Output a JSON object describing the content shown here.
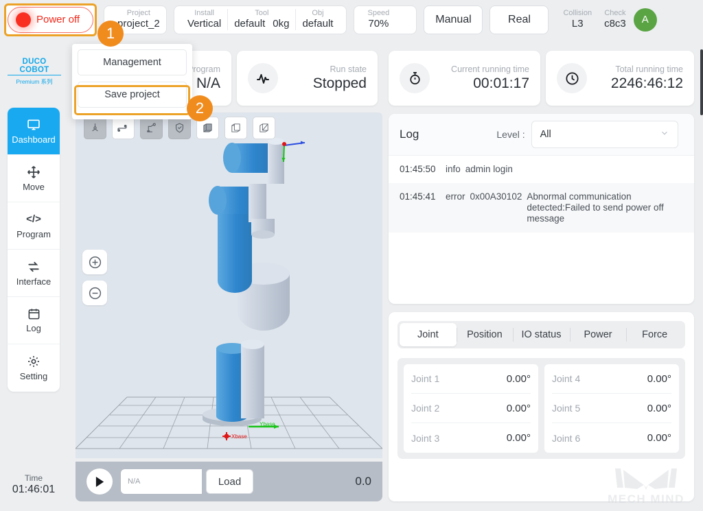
{
  "topbar": {
    "power": {
      "label": "Power off",
      "dot_color": "#f92f22",
      "highlight_color": "#eca227"
    },
    "project": {
      "key": "Project",
      "value": "project_2"
    },
    "install": {
      "key": "Install",
      "value": "Vertical"
    },
    "tool": {
      "key": "Tool",
      "value": "default",
      "payload": "0kg"
    },
    "obj": {
      "key": "Obj",
      "value": "default"
    },
    "speed": {
      "key": "Speed",
      "value": "70%"
    },
    "mode_button": "Manual",
    "real_button": "Real",
    "collision": {
      "key": "Collision",
      "value": "L3"
    },
    "check": {
      "key": "Check",
      "value": "c8c3"
    },
    "avatar": {
      "initial": "A",
      "color": "#5aa444"
    }
  },
  "branding": {
    "logo_main": "DUCO COBOT",
    "logo_sub": "Premium 系列",
    "color": "#13a7e8"
  },
  "sidebar": {
    "items": [
      {
        "label": "Dashboard",
        "icon": "monitor-icon",
        "active": true
      },
      {
        "label": "Move",
        "icon": "move-arrows-icon",
        "active": false
      },
      {
        "label": "Program",
        "icon": "code-icon",
        "active": false
      },
      {
        "label": "Interface",
        "icon": "exchange-icon",
        "active": false
      },
      {
        "label": "Log",
        "icon": "calendar-icon",
        "active": false
      },
      {
        "label": "Setting",
        "icon": "gear-icon",
        "active": false
      }
    ],
    "clock": {
      "key": "Time",
      "value": "01:46:01"
    }
  },
  "cards": {
    "program": {
      "key": "Program",
      "value": "N/A",
      "icon": "document-icon"
    },
    "run_state": {
      "key": "Run state",
      "value": "Stopped",
      "icon": "pulse-icon"
    },
    "current_running_time": {
      "key": "Current running time",
      "value": "00:01:17",
      "icon": "stopwatch-icon"
    },
    "total_running_time": {
      "key": "Total running time",
      "value": "2246:46:12",
      "icon": "clock-icon"
    }
  },
  "dropdown": {
    "items": [
      {
        "label": "Management",
        "highlighted": false
      },
      {
        "label": "Save project",
        "highlighted": true
      }
    ],
    "highlight_color": "#eca227"
  },
  "callouts": [
    {
      "number": "1",
      "color": "#f08b1d"
    },
    {
      "number": "2",
      "color": "#f08b1d"
    }
  ],
  "viewport": {
    "tools": [
      {
        "name": "axis-icon",
        "active": true
      },
      {
        "name": "path-icon",
        "active": false
      },
      {
        "name": "robot-icon",
        "active": true
      },
      {
        "name": "shield-icon",
        "active": true
      },
      {
        "name": "cube-solid-icon",
        "active": false
      },
      {
        "name": "cube-wire-icon",
        "active": false
      },
      {
        "name": "cube-outline-icon",
        "active": false
      }
    ],
    "zoom_in": "zoom-in-icon",
    "zoom_out": "zoom-out-icon",
    "axis_labels": {
      "x": "Xbase",
      "y": "Ybase"
    },
    "background": "#dfe5ec"
  },
  "runbar": {
    "play": "play-icon",
    "program_placeholder": "N/A",
    "load_label": "Load",
    "value": "0.0"
  },
  "log": {
    "title": "Log",
    "level_label": "Level :",
    "level_value": "All",
    "entries": [
      {
        "time": "01:45:50",
        "level": "info",
        "message": "admin login"
      },
      {
        "time": "01:45:41",
        "level": "error",
        "code": "0x00A30102",
        "message": "Abnormal communication detected:Failed to send power off message"
      }
    ]
  },
  "status": {
    "tabs": [
      {
        "label": "Joint",
        "active": true
      },
      {
        "label": "Position",
        "active": false
      },
      {
        "label": "IO status",
        "active": false
      },
      {
        "label": "Power",
        "active": false
      },
      {
        "label": "Force",
        "active": false
      }
    ],
    "joints_left": [
      {
        "name": "Joint 1",
        "value": "0.00°"
      },
      {
        "name": "Joint 2",
        "value": "0.00°"
      },
      {
        "name": "Joint 3",
        "value": "0.00°"
      }
    ],
    "joints_right": [
      {
        "name": "Joint 4",
        "value": "0.00°"
      },
      {
        "name": "Joint 5",
        "value": "0.00°"
      },
      {
        "name": "Joint 6",
        "value": "0.00°"
      }
    ]
  },
  "watermark": {
    "text": "MECH MIND"
  }
}
